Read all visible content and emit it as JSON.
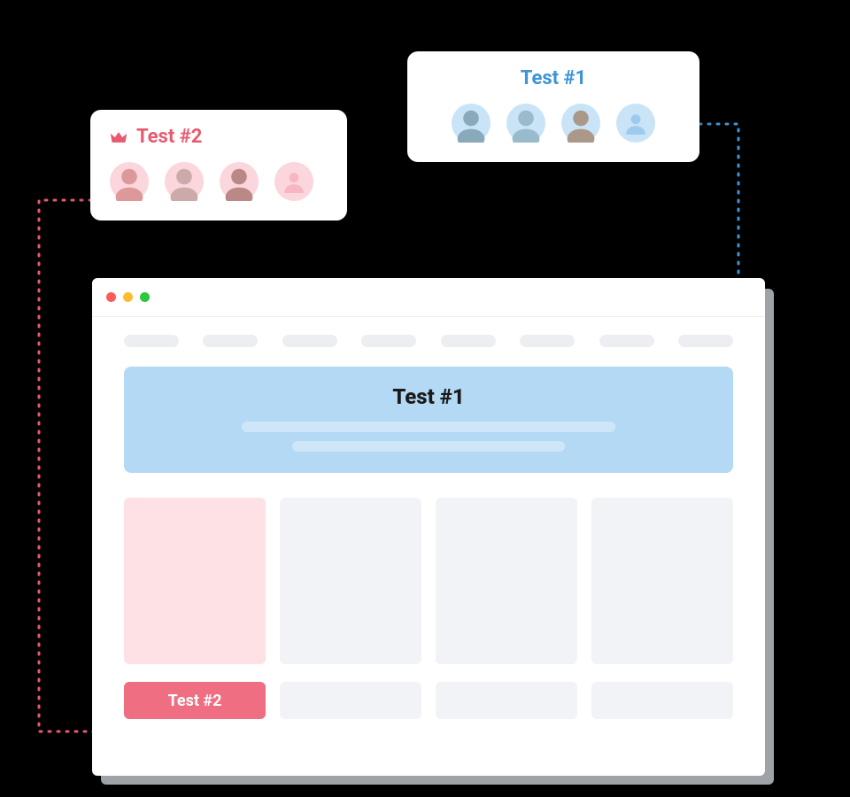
{
  "cards": {
    "test1": {
      "label": "Test #1",
      "color": "#3e95d6",
      "avatar_tint": "#c9e4f7"
    },
    "test2": {
      "label": "Test #2",
      "color": "#e85a71",
      "avatar_tint": "#fbd6dc"
    }
  },
  "window": {
    "hero_title": "Test #1",
    "bottom_label": "Test #2"
  },
  "colors": {
    "hero_blue": "#b4d9f4",
    "tile_pink": "#fde1e4",
    "tile_gray": "#f1f3f6",
    "chip_pink": "#ef6e82",
    "connector_blue": "#3e95d6",
    "connector_pink": "#e85a71"
  }
}
